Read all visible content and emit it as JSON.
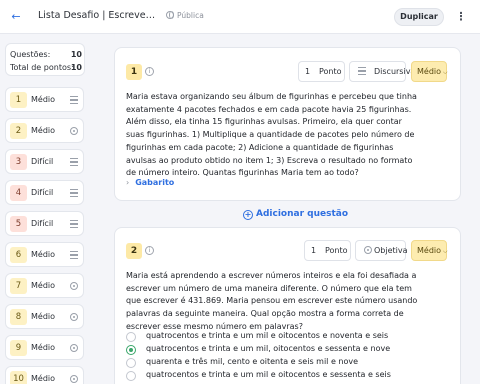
{
  "header": {
    "back_icon": "arrow-left-icon",
    "title": "Lista Desafio | Escrevendo ...",
    "visibility": "Pública",
    "duplicate_label": "Duplicar",
    "more_icon": "more-vertical-icon"
  },
  "stats": {
    "questions_label": "Questões:",
    "questions_value": "10",
    "points_label": "Total de pontos:",
    "points_value": "10"
  },
  "question_nav": [
    {
      "number": "1",
      "difficulty": "Médio",
      "type_icon": "lines-icon"
    },
    {
      "number": "2",
      "difficulty": "Médio",
      "type_icon": "radio-icon"
    },
    {
      "number": "3",
      "difficulty": "Difícil",
      "type_icon": "lines-icon"
    },
    {
      "number": "4",
      "difficulty": "Difícil",
      "type_icon": "lines-icon"
    },
    {
      "number": "5",
      "difficulty": "Difícil",
      "type_icon": "lines-icon"
    },
    {
      "number": "6",
      "difficulty": "Médio",
      "type_icon": "lines-icon"
    },
    {
      "number": "7",
      "difficulty": "Médio",
      "type_icon": "radio-icon"
    },
    {
      "number": "8",
      "difficulty": "Médio",
      "type_icon": "radio-icon"
    },
    {
      "number": "9",
      "difficulty": "Médio",
      "type_icon": "radio-icon"
    },
    {
      "number": "10",
      "difficulty": "Médio",
      "type_icon": "radio-icon"
    }
  ],
  "question1": {
    "number": "1",
    "points": "1",
    "points_label": "Ponto",
    "type": "Discursiva",
    "difficulty": "Médio",
    "text": "Maria estava organizando seu álbum de figurinhas e percebeu que tinha exatamente 4 pacotes fechados e em cada pacote havia 25 figurinhas. Além disso, ela tinha 15 figurinhas avulsas. Primeiro, ela quer contar suas figurinhas. 1) Multiplique a quantidade de pacotes pelo número de figurinhas em cada pacote; 2) Adicione a quantidade de figurinhas avulsas ao produto obtido no item 1; 3) Escreva o resultado no formato de número inteiro. Quantas figurinhas Maria tem ao todo?",
    "answer_label": "Gabarito"
  },
  "add_question_label": "Adicionar questão",
  "question2": {
    "number": "2",
    "points": "1",
    "points_label": "Ponto",
    "type": "Objetiva",
    "difficulty": "Médio",
    "text": "Maria está aprendendo a escrever números inteiros e ela foi desafiada a escrever um número de uma maneira diferente. O número que ela tem que escrever é 431.869. Maria pensou em escrever este número usando palavras da seguinte maneira. Qual opção mostra a forma correta de escrever esse mesmo número em palavras?",
    "options": [
      {
        "text": "quatrocentos e trinta e um mil e oitocentos e noventa e seis",
        "selected": false
      },
      {
        "text": "quatrocentos e trinta e um mil, oitocentos e sessenta e nove",
        "selected": true
      },
      {
        "text": "quarenta e três mil, cento e oitenta e seis mil e nove",
        "selected": false
      },
      {
        "text": "quatrocentos e trinta e um mil e oitocentos e sessenta e seis",
        "selected": false
      }
    ]
  },
  "colors": {
    "accent": "#2f6fe0",
    "medium_badge": "#fdf1c4",
    "hard_badge": "#fde0da",
    "difficulty_select": "#fdecb0",
    "correct": "#3aa66a"
  }
}
